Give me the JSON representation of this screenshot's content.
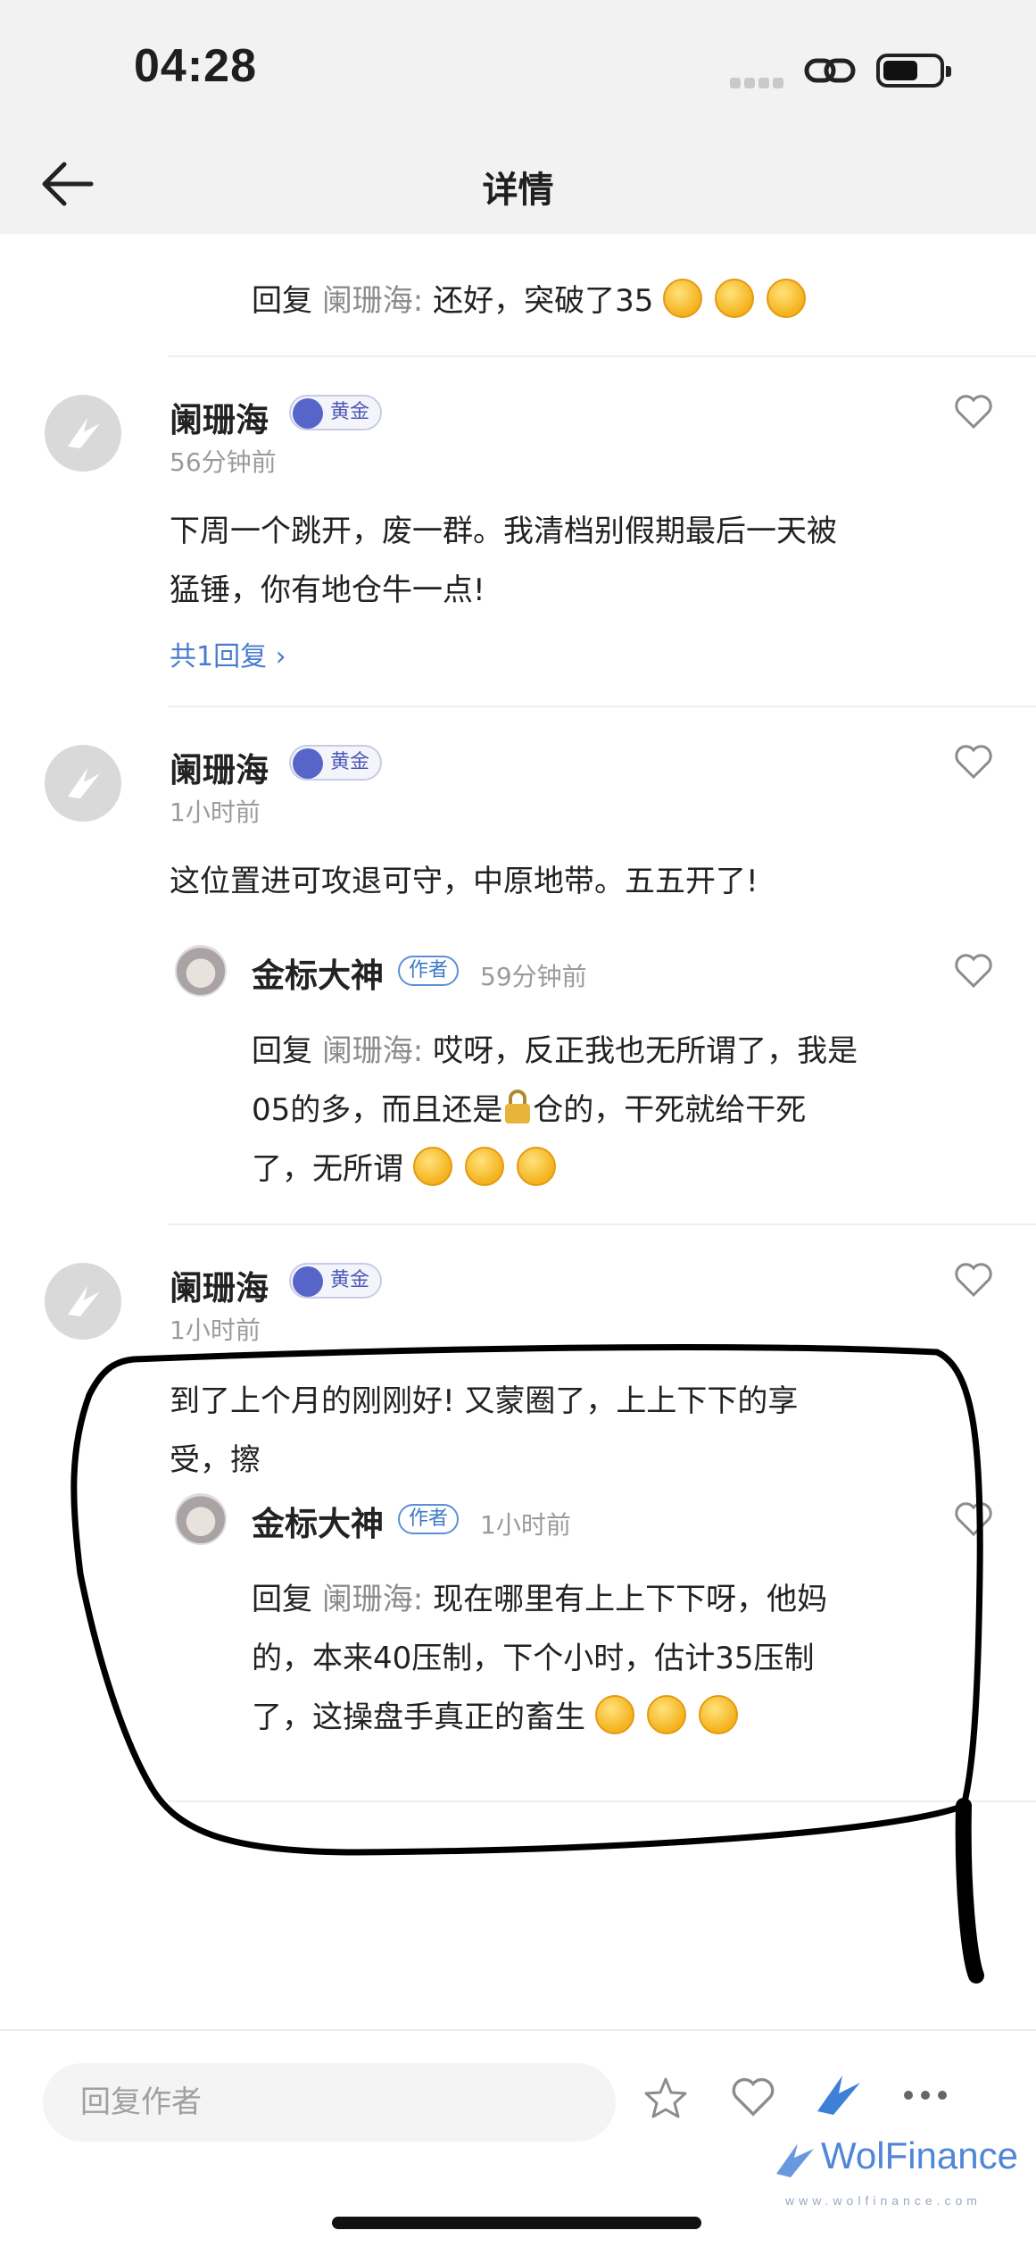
{
  "status": {
    "time": "04:28"
  },
  "nav": {
    "title": "详情"
  },
  "comments": [
    {
      "top_reply": {
        "label": "回复",
        "to": "阑珊海:",
        "text": "还好，突破了35"
      }
    },
    {
      "user": "阑珊海",
      "badge": "黄金",
      "time": "56分钟前",
      "text_line1": "下周一个跳开，废一群。我清档别假期最后一天被",
      "text_line2": "猛锤，你有地仓牛一点!",
      "more": "共1回复"
    },
    {
      "user": "阑珊海",
      "badge": "黄金",
      "time": "1小时前",
      "text_line1": "这位置进可攻退可守，中原地带。五五开了!",
      "reply": {
        "user": "金标大神",
        "badge": "作者",
        "time": "59分钟前",
        "label": "回复",
        "to": "阑珊海:",
        "line1": "哎呀，反正我也无所谓了，我是",
        "line2a": "05的多，而且还是",
        "line2b": "仓的，干死就给干死",
        "line3": "了，无所谓"
      }
    },
    {
      "user": "阑珊海",
      "badge": "黄金",
      "time": "1小时前",
      "text_line1": "到了上个月的刚刚好! 又蒙圈了，上上下下的享",
      "text_line2": "受，擦",
      "reply": {
        "user": "金标大神",
        "badge": "作者",
        "time": "1小时前",
        "label": "回复",
        "to": "阑珊海:",
        "line1": "现在哪里有上上下下呀，他妈",
        "line2": "的，本来40压制，下个小时，估计35压制",
        "line3": "了，这操盘手真正的畜生"
      }
    }
  ],
  "bottom": {
    "reply_placeholder": "回复作者",
    "watermark": "WolFinance",
    "watermark_sub": "www.wolfinance.com"
  },
  "icons": [
    "back-arrow-icon",
    "star-icon",
    "heart-icon",
    "share-bird-icon",
    "more-dots-icon"
  ]
}
